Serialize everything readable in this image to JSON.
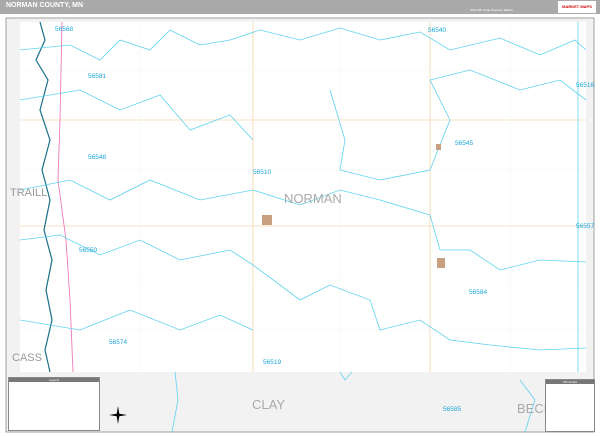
{
  "title": "NORMAN COUNTY, MN",
  "edition": "2020 ZIP Code Premium Edition",
  "logo": "MARKET MAPS",
  "colors": {
    "zip_boundary": "#5fd3ef",
    "river": "#1a6f8a",
    "road": "#f5c48c",
    "highway": "#f07ab8",
    "neighbor_fill": "#f2f2f2",
    "title_bar": "#a9a9a9"
  },
  "county_label": "NORMAN",
  "neighbors": [
    "TRAILL",
    "CASS",
    "CLAY",
    "BECK"
  ],
  "zips": [
    "56568",
    "56540",
    "56516",
    "56581",
    "56545",
    "56548",
    "56510",
    "56557",
    "56550",
    "56584",
    "56574",
    "56519",
    "56585"
  ],
  "legend_title": "Legend",
  "ziplist_title": "ZIP Codes",
  "compass": "compass-rose-icon"
}
